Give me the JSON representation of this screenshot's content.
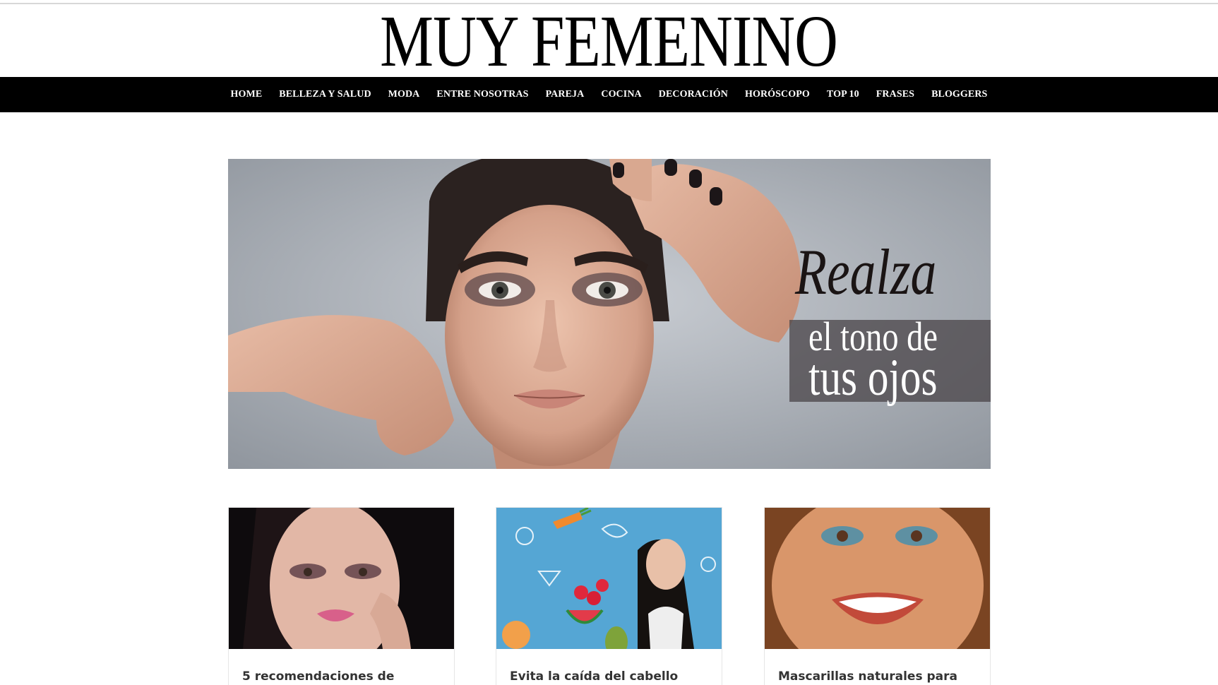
{
  "site": {
    "logo": "MUY FEMENINO"
  },
  "nav": {
    "items": [
      {
        "label": "HOME"
      },
      {
        "label": "BELLEZA Y SALUD"
      },
      {
        "label": "MODA"
      },
      {
        "label": "ENTRE NOSOTRAS"
      },
      {
        "label": "PAREJA"
      },
      {
        "label": "COCINA"
      },
      {
        "label": "DECORACIÓN"
      },
      {
        "label": "HORÓSCOPO"
      },
      {
        "label": "TOP 10"
      },
      {
        "label": "FRASES"
      },
      {
        "label": "BLOGGERS"
      }
    ]
  },
  "hero": {
    "headline": "Realza",
    "line1": "el tono de",
    "line2": "tus ojos"
  },
  "cards": [
    {
      "title": "5 recomendaciones de"
    },
    {
      "title": "Evita la caída del cabello"
    },
    {
      "title": "Mascarillas naturales para"
    }
  ],
  "colors": {
    "nav_bg": "#000000",
    "text": "#333333"
  }
}
